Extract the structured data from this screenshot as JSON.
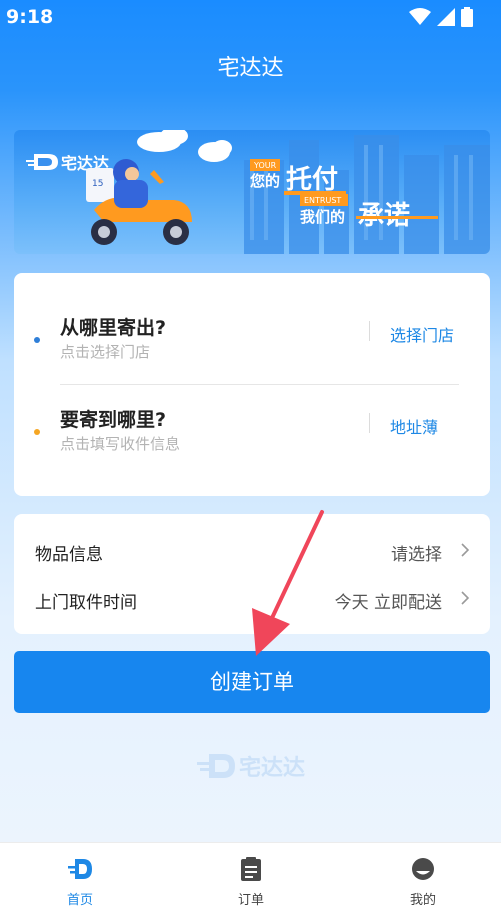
{
  "status_bar": {
    "time": "9:18"
  },
  "header": {
    "title": "宅达达"
  },
  "banner": {
    "logo_text": "宅达达",
    "line1_tag": "YOUR",
    "line1_prefix": "您的",
    "line1_main": "托付",
    "line2_tag": "ENTRUST",
    "line2_prefix": "我们的",
    "line2_main": "承诺",
    "scooter_plate": "15"
  },
  "address": {
    "sender": {
      "title": "从哪里寄出?",
      "subtitle": "点击选择门店",
      "action": "选择门店",
      "dot_color": "#2f7fd8"
    },
    "receiver": {
      "title": "要寄到哪里?",
      "subtitle": "点击填写收件信息",
      "action": "地址薄",
      "dot_color": "#f5a623"
    }
  },
  "info": {
    "item": {
      "label": "物品信息",
      "value": "请选择"
    },
    "pickup": {
      "label": "上门取件时间",
      "value": "今天 立即配送"
    }
  },
  "create_button": {
    "label": "创建订单"
  },
  "watermark": {
    "text": "宅达达"
  },
  "tabs": [
    {
      "label": "首页",
      "icon": "home-logo-icon",
      "active": true
    },
    {
      "label": "订单",
      "icon": "clipboard-icon",
      "active": false
    },
    {
      "label": "我的",
      "icon": "profile-icon",
      "active": false
    }
  ],
  "colors": {
    "accent": "#1786ef",
    "arrow": "#f0465a"
  }
}
